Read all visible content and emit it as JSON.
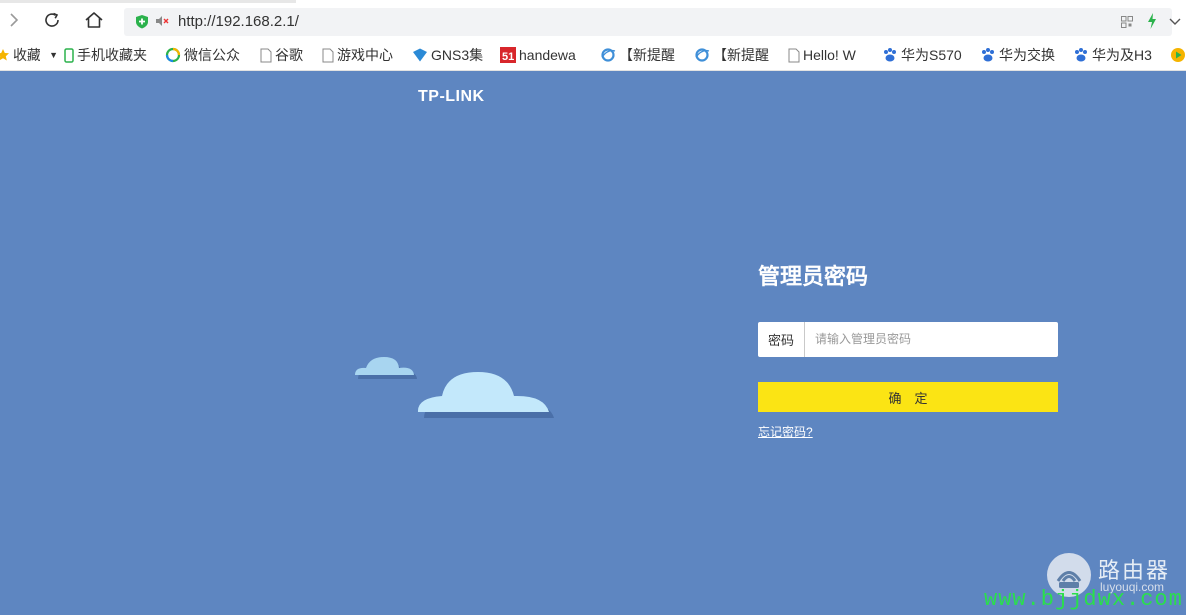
{
  "browser": {
    "url": "http://192.168.2.1/",
    "bookmarks": [
      {
        "label": "收藏",
        "icon": "star-icon"
      },
      {
        "label": "手机收藏夹",
        "icon": "phone-icon"
      },
      {
        "label": "微信公众",
        "icon": "wechat-icon"
      },
      {
        "label": "谷歌",
        "icon": "page-icon"
      },
      {
        "label": "游戏中心",
        "icon": "page-icon"
      },
      {
        "label": "GNS3集",
        "icon": "gns3-icon"
      },
      {
        "label": "handewa",
        "icon": "51-icon"
      },
      {
        "label": "【新提醒",
        "icon": "ie-icon"
      },
      {
        "label": "【新提醒",
        "icon": "ie-icon"
      },
      {
        "label": "Hello! W",
        "icon": "page-icon"
      },
      {
        "label": "华为S570",
        "icon": "baidu-icon"
      },
      {
        "label": "华为交换",
        "icon": "baidu-icon"
      },
      {
        "label": "华为及H3",
        "icon": "baidu-icon"
      }
    ]
  },
  "page": {
    "logo": "TP-LINK",
    "title": "管理员密码",
    "password_label": "密码",
    "password_placeholder": "请输入管理员密码",
    "confirm_label": "确　定",
    "forgot_label": "忘记密码?"
  },
  "watermark": {
    "title": "路由器",
    "sub": "luyouqi.com",
    "domain": "www.bjjdwx.com"
  },
  "colors": {
    "background": "#5e86c1",
    "confirm_button": "#fbe414",
    "watermark_domain": "#2adf4c"
  }
}
